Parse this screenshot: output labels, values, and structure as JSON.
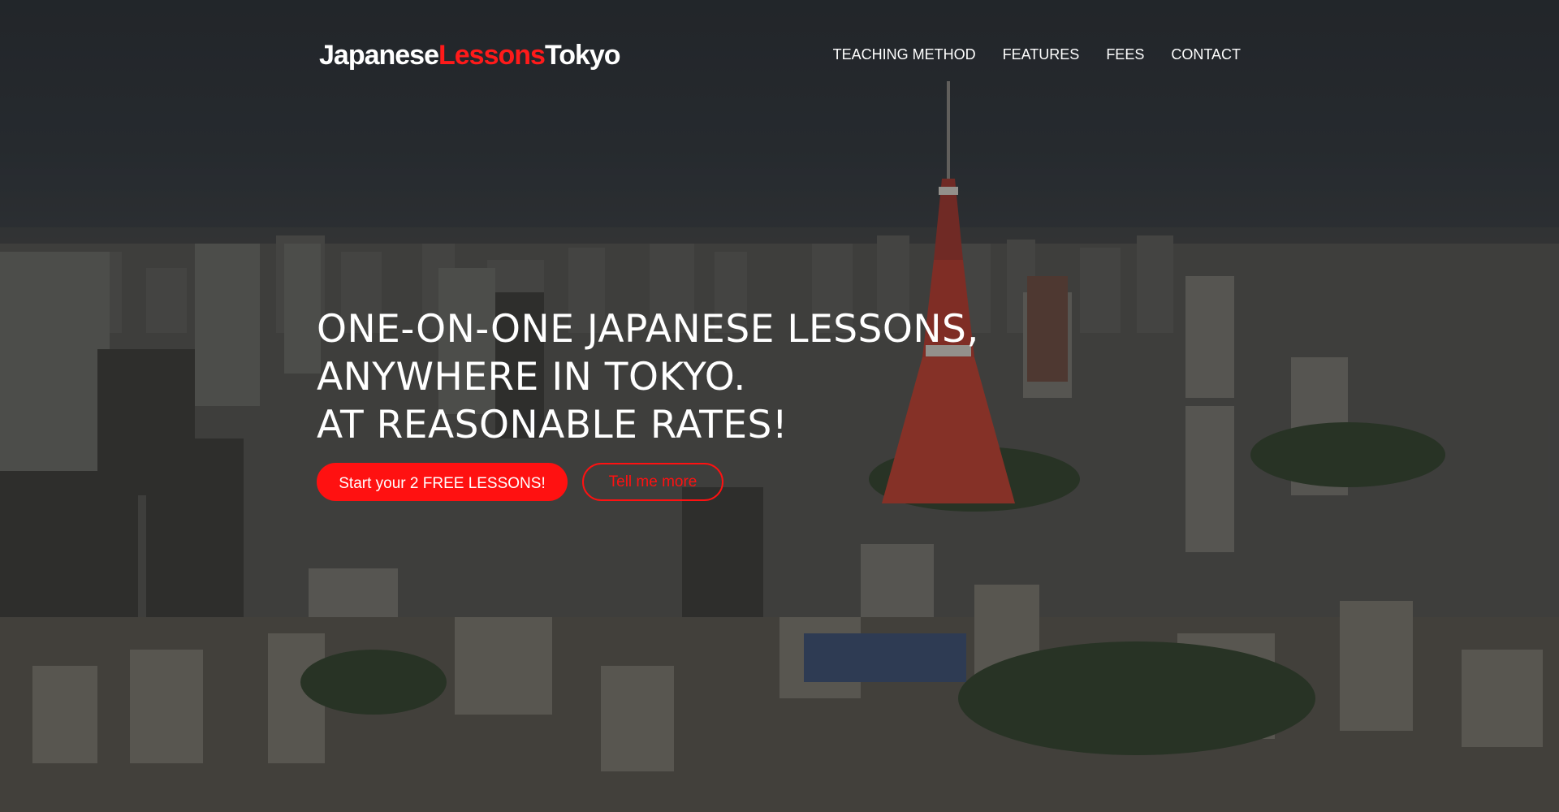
{
  "header": {
    "logo": {
      "part1": "Japanese",
      "part2": "Lessons",
      "part3": "Tokyo"
    },
    "nav": [
      {
        "label": "TEACHING METHOD"
      },
      {
        "label": "FEATURES"
      },
      {
        "label": "FEES"
      },
      {
        "label": "CONTACT"
      }
    ]
  },
  "hero": {
    "headline_lines": [
      "ONE-ON-ONE JAPANESE LESSONS,",
      "ANYWHERE IN TOKYO.",
      "AT REASONABLE RATES!"
    ],
    "primary_button": "Start your 2 FREE LESSONS!",
    "secondary_button": "Tell me more"
  },
  "colors": {
    "brand_red": "#ff1111",
    "text": "#ffffff",
    "background": "#2b2e31"
  },
  "background_image": "tokyo-cityscape-with-tokyo-tower"
}
